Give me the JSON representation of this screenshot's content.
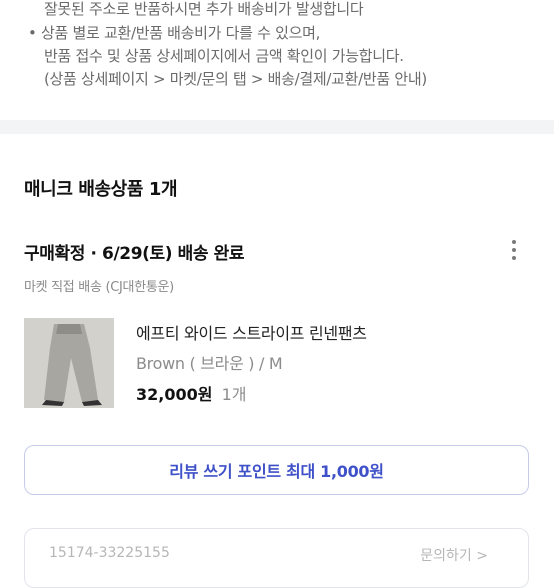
{
  "notice": {
    "lines": [
      "잘못된 주소로 반품하시면 추가 배송비가 발생합니다",
      "• 상품 별로 교환/반품 배송비가 다를 수 있으며,",
      "반품 접수 및 상품 상세페이지에서 금액 확인이 가능합니다.",
      "(상품 상세페이지 > 마켓/문의 탭 > 배송/결제/교환/반품 안내)"
    ]
  },
  "shipment": {
    "title": "매니크 배송상품 1개",
    "status": "구매확정 · 6/29(토) 배송 완료",
    "carrier": "마켓 직접 배송 (CJ대한통운)",
    "more_icon": "more-vertical-icon"
  },
  "product": {
    "name": "에프티 와이드 스트라이프 린넨팬츠",
    "option": "Brown ( 브라운 ) / M",
    "price": "32,000원",
    "quantity": "1개",
    "thumbnail_color": "#cfcdc8"
  },
  "review_button": {
    "label": "리뷰 쓰기 포인트 최대 1,000원",
    "accent": "#3f51c9"
  },
  "next_card": {
    "order_no": "15174-33225155",
    "inquiry": "문의하기 >"
  }
}
